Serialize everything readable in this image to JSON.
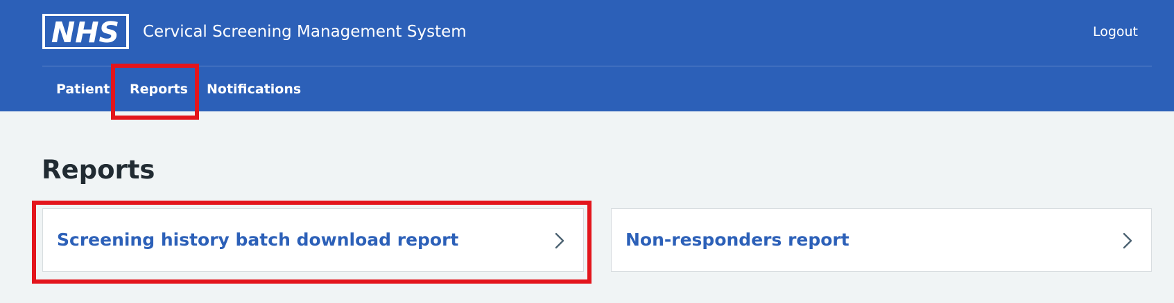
{
  "header": {
    "logo_text": "NHS",
    "service_name": "Cervical Screening Management System",
    "logout_label": "Logout",
    "background_color": "#2c60b8"
  },
  "nav": {
    "items": [
      {
        "label": "Patient"
      },
      {
        "label": "Reports"
      },
      {
        "label": "Notifications"
      }
    ]
  },
  "main": {
    "title": "Reports",
    "cards": [
      {
        "label": "Screening history batch download report",
        "icon": "chevron-right-icon"
      },
      {
        "label": "Non-responders report",
        "icon": "chevron-right-icon"
      }
    ]
  },
  "annotations": {
    "highlight_color": "#e3151c"
  }
}
